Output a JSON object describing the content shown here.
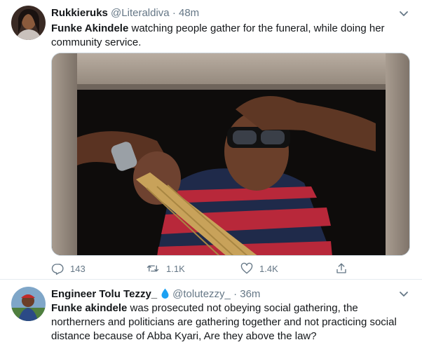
{
  "tweets": [
    {
      "display_name": "Rukkieruks",
      "handle": "@Literaldiva",
      "separator": "·",
      "time": "48m",
      "lead": "Funke Akindele",
      "text": " watching people gather for the funeral, while doing her community service.",
      "replies": "143",
      "retweets": "1.1K",
      "likes": "1.4K"
    },
    {
      "display_name": "Engineer Tolu Tezzy_",
      "handle": "@tolutezzy_",
      "separator": "·",
      "time": "36m",
      "lead": "Funke akindele",
      "text": " was prosecuted not obeying social gathering, the northerners and politicians are gathering together and not practicing social distance because of Abba Kyari, Are they above the law?"
    }
  ],
  "icons": {
    "caret": "chevron-down-icon",
    "reply": "reply-icon",
    "retweet": "retweet-icon",
    "like": "heart-icon",
    "share": "share-icon",
    "droplet": "droplet-emoji-icon"
  },
  "colors": {
    "text_primary": "#14171a",
    "text_secondary": "#657786",
    "divider": "#e6ecf0",
    "droplet": "#1da1f2"
  }
}
